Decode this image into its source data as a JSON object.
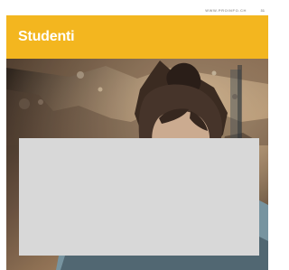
{
  "header": {
    "url": "WWW.PROINFO.CH",
    "page_number": "31"
  },
  "section": {
    "title": "Studenti"
  },
  "colors": {
    "accent": "#f3b61f",
    "panel": "#d8d8d8",
    "title_text": "#ffffff"
  }
}
